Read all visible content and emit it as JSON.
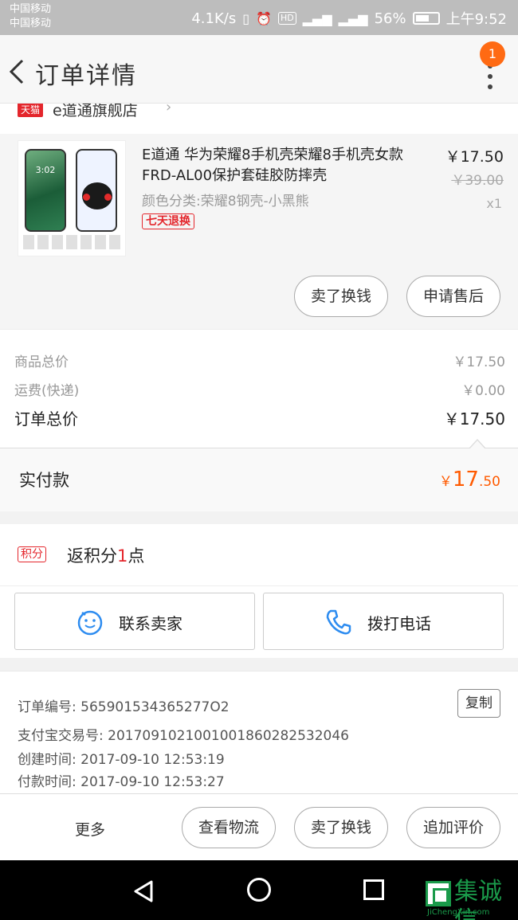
{
  "status_bar": {
    "carrier_1": "中国移动",
    "carrier_2": "中国移动",
    "speed": "4.1K/s",
    "battery": "56%",
    "time": "上午9:52"
  },
  "header": {
    "title": "订单详情",
    "notification_count": "1"
  },
  "shop": {
    "badge": "天猫",
    "name": "e道通旗舰店"
  },
  "product": {
    "title": "E道通 华为荣耀8手机壳荣耀8手机壳女款FRD-AL00保护套硅胶防摔壳",
    "sku": "颜色分类:荣耀8钢壳-小黑熊",
    "return_badge": "七天退换",
    "price": "￥17.50",
    "original_price": "￥39.00",
    "quantity": "x1",
    "thumb_clock": "3:02",
    "btn_sell": "卖了换钱",
    "btn_aftersale": "申请售后"
  },
  "totals": {
    "goods_label": "商品总价",
    "goods_value": "￥17.50",
    "shipping_label": "运费(快递)",
    "shipping_value": "￥0.00",
    "order_total_label": "订单总价",
    "order_total_value": "￥17.50",
    "paid_label": "实付款",
    "paid_yen": "￥",
    "paid_int": "17",
    "paid_dec": ".50"
  },
  "points": {
    "badge": "积分",
    "text_prefix": "返积分",
    "count": "1",
    "text_suffix": "点"
  },
  "contact": {
    "seller": "联系卖家",
    "call": "拨打电话"
  },
  "order_info": {
    "order_no": "订单编号: 565901534365277O2",
    "alipay_no": "支付宝交易号: 2017091021001001860282532046",
    "created": "创建时间: 2017-09-10 12:53:19",
    "paid": "付款时间: 2017-09-10 12:53:27",
    "copy": "复制"
  },
  "action_bar": {
    "more": "更多",
    "logistics": "查看物流",
    "sell": "卖了换钱",
    "review": "追加评价"
  },
  "watermark": {
    "text": "集诚信",
    "url": "JiChengXin.com"
  },
  "colors": {
    "accent": "#ff5a00",
    "red": "#e4262c",
    "blue": "#2d8cf0"
  }
}
